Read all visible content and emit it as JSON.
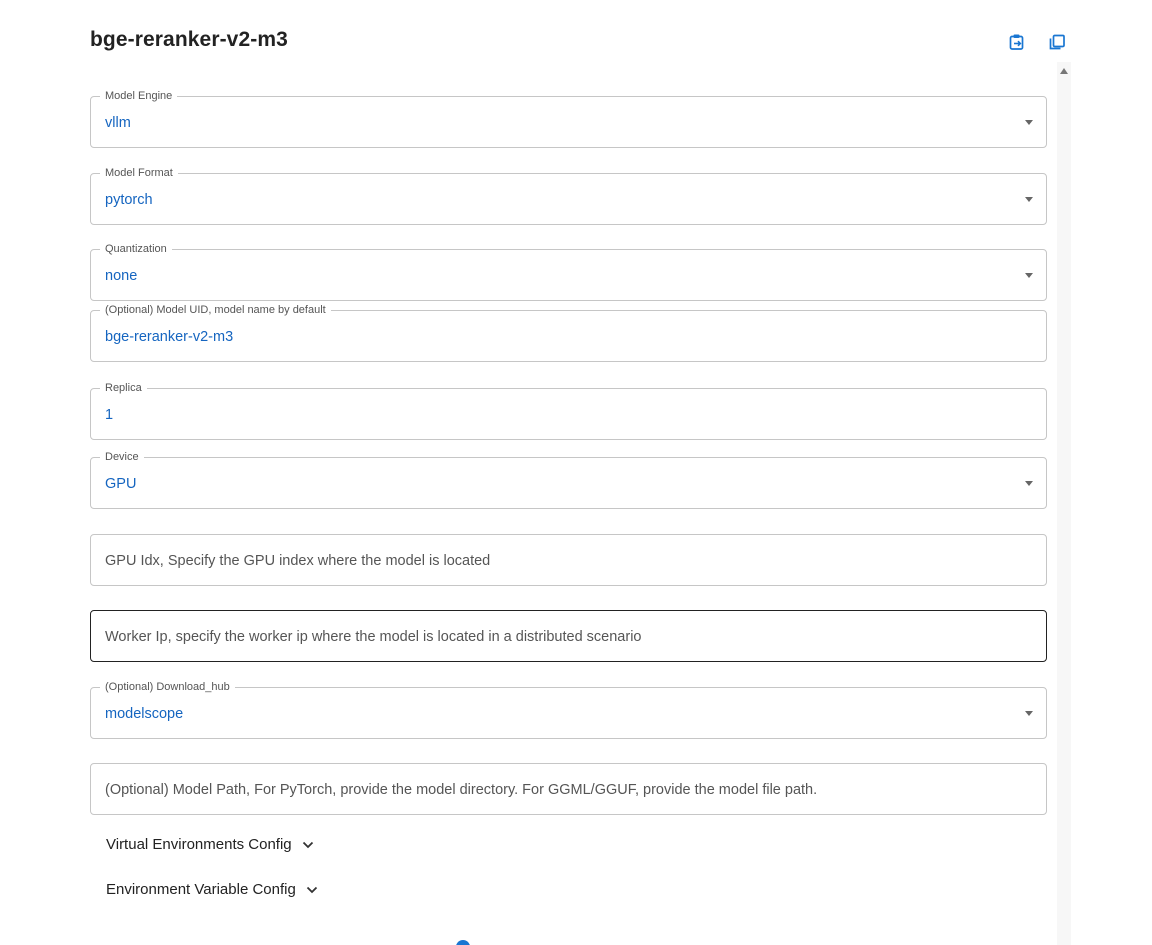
{
  "title": "bge-reranker-v2-m3",
  "header_icons": [
    "copy-config-icon",
    "duplicate-icon"
  ],
  "fields": {
    "model_engine": {
      "label": "Model Engine",
      "value": "vllm"
    },
    "model_format": {
      "label": "Model Format",
      "value": "pytorch"
    },
    "quantization": {
      "label": "Quantization",
      "value": "none"
    },
    "model_uid": {
      "label": "(Optional) Model UID, model name by default",
      "value": "bge-reranker-v2-m3"
    },
    "replica": {
      "label": "Replica",
      "value": "1"
    },
    "device": {
      "label": "Device",
      "value": "GPU"
    },
    "gpu_idx": {
      "placeholder": "GPU Idx, Specify the GPU index where the model is located"
    },
    "worker_ip": {
      "placeholder": "Worker Ip, specify the worker ip where the model is located in a distributed scenario"
    },
    "download_hub": {
      "label": "(Optional) Download_hub",
      "value": "modelscope"
    },
    "model_path": {
      "placeholder": "(Optional) Model Path, For PyTorch, provide the model directory. For GGML/GGUF, provide the model file path."
    }
  },
  "accordions": {
    "virtual_env": "Virtual Environments Config",
    "env_vars": "Environment Variable Config"
  },
  "colors": {
    "value_text": "#1565c0",
    "border": "#c6c6c6",
    "focused_border": "#222222",
    "icon": "#1976d2"
  }
}
